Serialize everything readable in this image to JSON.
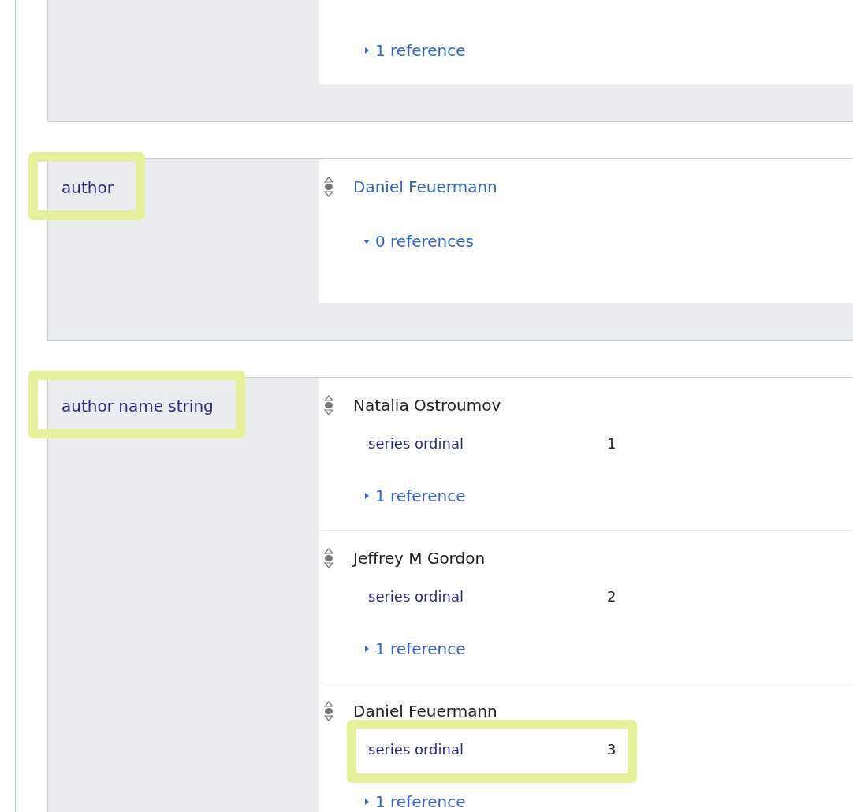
{
  "statement_groups": [
    {
      "values": [
        {
          "references": "1 reference",
          "references_expanded": false
        }
      ]
    },
    {
      "property": "author",
      "highlighted": true,
      "values": [
        {
          "value": "Daniel Feuermann",
          "kind": "item",
          "references": "0 references",
          "references_expanded": true
        }
      ]
    },
    {
      "property": "author name string",
      "highlighted": true,
      "values": [
        {
          "value": "Natalia Ostroumov",
          "kind": "string",
          "qualifiers": [
            {
              "property": "series ordinal",
              "value": "1",
              "highlighted": false
            }
          ],
          "references": "1 reference",
          "references_expanded": false
        },
        {
          "value": "Jeffrey M Gordon",
          "kind": "string",
          "qualifiers": [
            {
              "property": "series ordinal",
              "value": "2",
              "highlighted": false
            }
          ],
          "references": "1 reference",
          "references_expanded": false
        },
        {
          "value": "Daniel Feuermann",
          "kind": "string",
          "qualifiers": [
            {
              "property": "series ordinal",
              "value": "3",
              "highlighted": true
            }
          ],
          "references": "1 reference",
          "references_expanded": false
        }
      ]
    }
  ]
}
